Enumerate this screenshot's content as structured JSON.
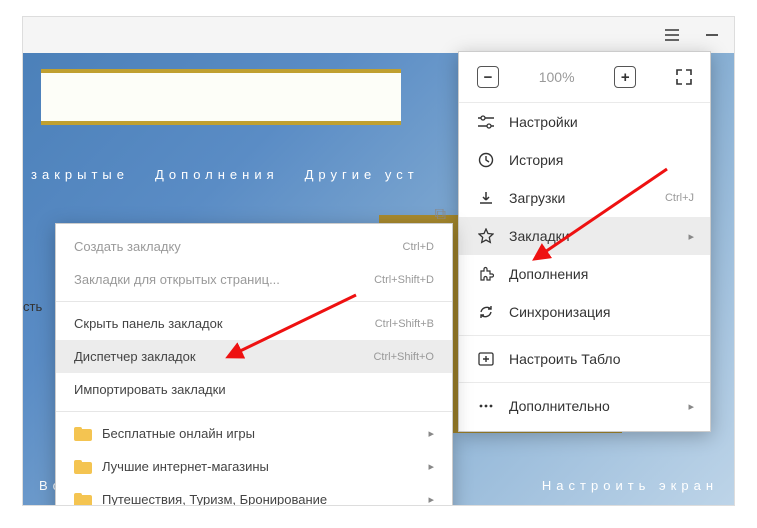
{
  "titlebar": {
    "hamburger": "menu-icon",
    "minimize": "minimize-icon"
  },
  "page": {
    "tabs": [
      "закрытые",
      "Дополнения",
      "Другие уст"
    ],
    "partial": "сть",
    "bottom_left": "Во",
    "bottom_right": "Настроить экран"
  },
  "main_menu": {
    "zoom": {
      "value": "100%"
    },
    "items": [
      {
        "icon": "settings-sliders-icon",
        "label": "Настройки"
      },
      {
        "icon": "history-icon",
        "label": "История"
      },
      {
        "icon": "download-icon",
        "label": "Загрузки",
        "shortcut": "Ctrl+J"
      },
      {
        "icon": "star-icon",
        "label": "Закладки",
        "submenu": true,
        "hover": true
      },
      {
        "icon": "puzzle-icon",
        "label": "Дополнения"
      },
      {
        "icon": "sync-icon",
        "label": "Синхронизация"
      },
      {
        "icon": "add-tile-icon",
        "label": "Настроить Табло"
      },
      {
        "icon": "more-icon",
        "label": "Дополнительно",
        "submenu": true
      }
    ]
  },
  "sub_menu": {
    "items": [
      {
        "label": "Создать закладку",
        "shortcut": "Ctrl+D",
        "disabled": true
      },
      {
        "label": "Закладки для открытых страниц...",
        "shortcut": "Ctrl+Shift+D",
        "disabled": true
      },
      {
        "sep": true
      },
      {
        "label": "Скрыть панель закладок",
        "shortcut": "Ctrl+Shift+B"
      },
      {
        "label": "Диспетчер закладок",
        "shortcut": "Ctrl+Shift+O",
        "hover": true
      },
      {
        "label": "Импортировать закладки"
      },
      {
        "sep": true
      },
      {
        "label": "Бесплатные онлайн игры",
        "folder": true,
        "submenu": true
      },
      {
        "label": "Лучшие интернет-магазины",
        "folder": true,
        "submenu": true
      },
      {
        "label": "Путешествия, Туризм, Бронирование",
        "folder": true,
        "submenu": true
      }
    ]
  }
}
